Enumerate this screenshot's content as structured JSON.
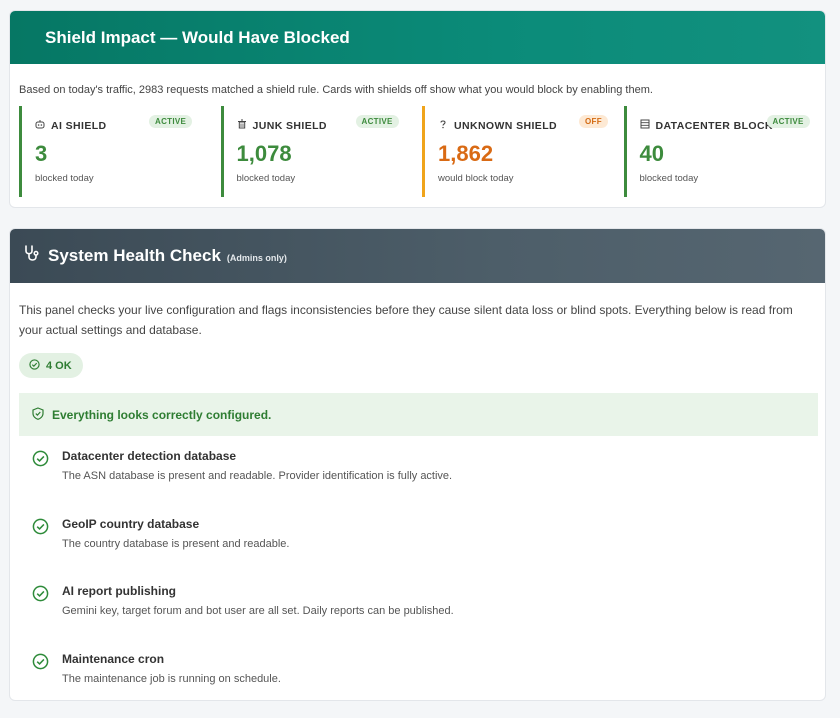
{
  "impact": {
    "title": "Shield Impact — Would Have Blocked",
    "description": "Based on today's traffic, 2983 requests matched a shield rule. Cards with shields off show what you would block by enabling them.",
    "cards": [
      {
        "icon": "robot-icon",
        "label": "AI SHIELD",
        "badge": "ACTIVE",
        "value": "3",
        "sub": "blocked today"
      },
      {
        "icon": "trash-icon",
        "label": "JUNK SHIELD",
        "badge": "ACTIVE",
        "value": "1,078",
        "sub": "blocked today"
      },
      {
        "icon": "question-icon",
        "label": "UNKNOWN SHIELD",
        "badge": "OFF",
        "value": "1,862",
        "sub": "would block today"
      },
      {
        "icon": "server-icon",
        "label": "DATACENTER BLOCK",
        "badge": "ACTIVE",
        "value": "40",
        "sub": "blocked today"
      }
    ],
    "colors": {
      "active": "#3d8b3d",
      "warn": "#d96a14",
      "header": "#067764"
    }
  },
  "health": {
    "title": "System Health Check",
    "subtitle": "(Admins only)",
    "description": "This panel checks your live configuration and flags inconsistencies before they cause silent data loss or blind spots. Everything below is read from your actual settings and database.",
    "ok_count": "4 OK",
    "banner": "Everything looks correctly configured.",
    "checks": [
      {
        "title": "Datacenter detection database",
        "desc": "The ASN database is present and readable. Provider identification is fully active."
      },
      {
        "title": "GeoIP country database",
        "desc": "The country database is present and readable."
      },
      {
        "title": "AI report publishing",
        "desc": "Gemini key, target forum and bot user are all set. Daily reports can be published."
      },
      {
        "title": "Maintenance cron",
        "desc": "The maintenance job is running on schedule."
      }
    ],
    "colors": {
      "ok": "#2e7d32",
      "header": "#3b4a55"
    }
  }
}
